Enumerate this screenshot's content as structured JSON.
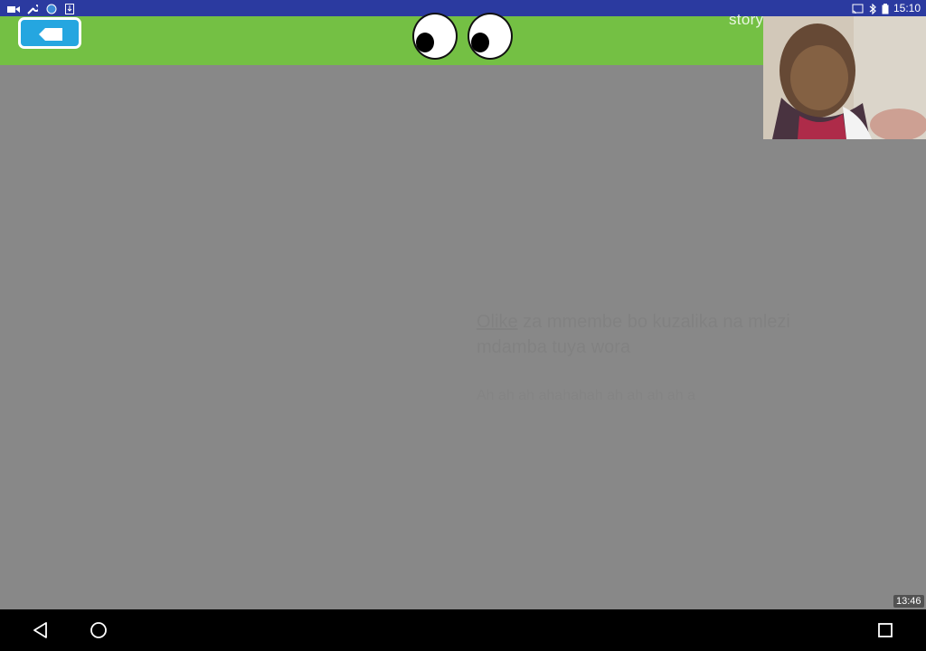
{
  "status_bar": {
    "time": "15:10",
    "left_icons": [
      "video-camera-icon",
      "wrench-icon",
      "globe-icon",
      "download-icon"
    ],
    "right_icons": [
      "cast-icon",
      "bluetooth-icon",
      "battery-icon"
    ]
  },
  "top_bar": {
    "title": "story...",
    "back_button_icon": "back-arrow-icon",
    "mascot": "googly-eyes"
  },
  "main": {
    "ghost_text_word": "Olike",
    "ghost_text_rest": " za mmembe bo kuzalika na mlezi mdamba tuya wora",
    "ghost_line": "Ah ah ah ahahahah ah ah ah ah a"
  },
  "video_overlay": {
    "timestamp": "13:46"
  },
  "nav_bar": {
    "buttons": [
      "back-triangle-icon",
      "home-circle-icon",
      "recents-square-icon"
    ]
  },
  "colors": {
    "status_bar": "#2b3aa0",
    "top_bar": "#74c044",
    "back_button": "#25a6e0",
    "overlay": "#888888",
    "nav_bar": "#000000"
  }
}
